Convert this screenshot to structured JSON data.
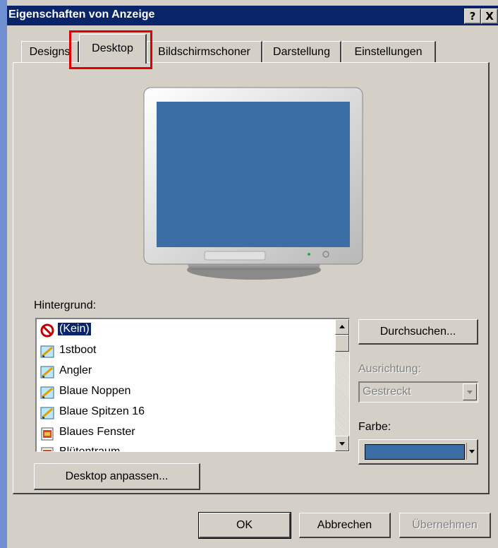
{
  "window": {
    "title": "Eigenschaften von Anzeige",
    "help_button": "?",
    "close_button": "X"
  },
  "tabs": [
    {
      "label": "Designs"
    },
    {
      "label": "Desktop",
      "active": true
    },
    {
      "label": "Bildschirmschoner"
    },
    {
      "label": "Darstellung"
    },
    {
      "label": "Einstellungen"
    }
  ],
  "background": {
    "label": "Hintergrund:",
    "items": [
      {
        "label": "(Kein)",
        "icon": "none-icon",
        "selected": true
      },
      {
        "label": "1stboot",
        "icon": "image-file-icon"
      },
      {
        "label": "Angler",
        "icon": "image-file-icon"
      },
      {
        "label": "Blaue Noppen",
        "icon": "image-file-icon"
      },
      {
        "label": "Blaue Spitzen 16",
        "icon": "image-file-icon"
      },
      {
        "label": "Blaues Fenster",
        "icon": "html-file-icon"
      },
      {
        "label": "Blütentraum",
        "icon": "html-file-icon"
      }
    ]
  },
  "browse_button": "Durchsuchen...",
  "position": {
    "label": "Ausrichtung:",
    "value": "Gestreckt"
  },
  "color": {
    "label": "Farbe:",
    "value": "#3a6ea5"
  },
  "customize_button": "Desktop anpassen...",
  "footer": {
    "ok": "OK",
    "cancel": "Abbrechen",
    "apply": "Übernehmen"
  },
  "colors": {
    "titlebar": "#0a246a",
    "desktop_preview": "#3a6ea5",
    "highlight_box": "#e00000",
    "dialog_face": "#d4d0c8"
  }
}
